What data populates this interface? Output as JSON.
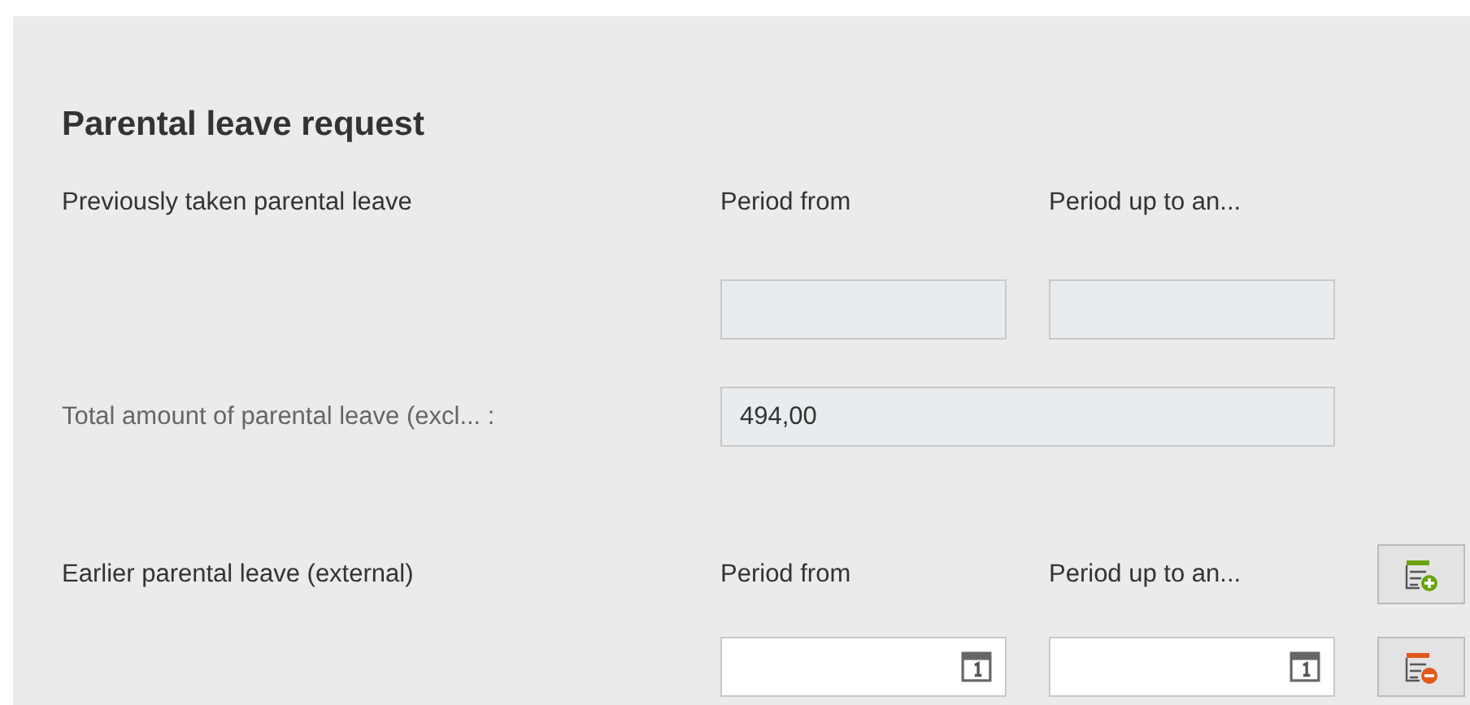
{
  "title": "Parental leave request",
  "rows": [
    {
      "kind": "header",
      "label": "Previously taken parental leave",
      "columns": [
        "Period from",
        "Period up to an..."
      ]
    },
    {
      "kind": "dates",
      "fields": [
        {
          "disabled": true
        },
        {
          "disabled": true
        }
      ]
    },
    {
      "kind": "total",
      "label": "Total amount of parental leave (excl... :",
      "value": "494,00",
      "disabled": true
    },
    {
      "kind": "header",
      "label": "Earlier parental leave (external)",
      "columns": [
        "Period from",
        "Period up to an..."
      ],
      "button": {
        "kind": "add"
      }
    },
    {
      "kind": "dates",
      "fields": [
        {
          "disabled": false
        },
        {
          "disabled": false
        }
      ],
      "button": {
        "kind": "remove"
      }
    }
  ]
}
